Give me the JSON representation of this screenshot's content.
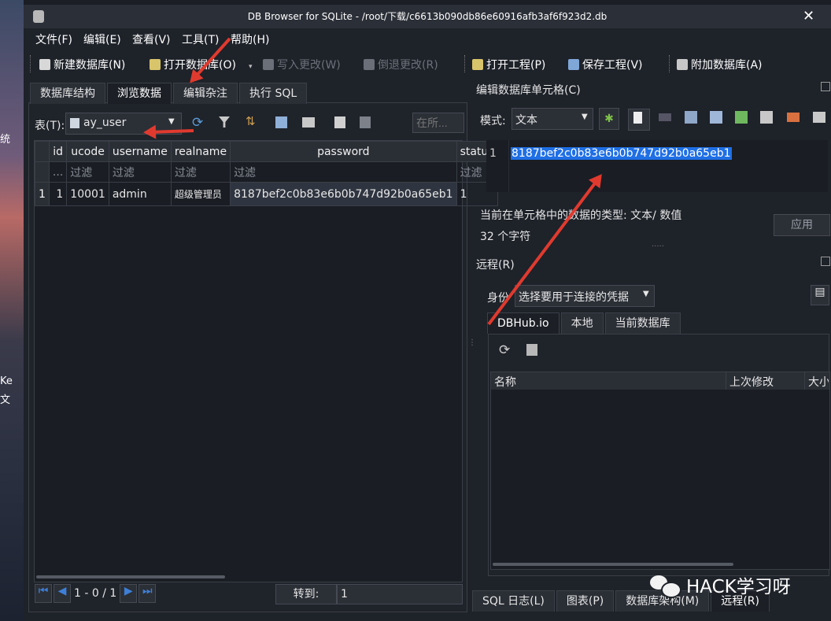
{
  "window": {
    "title": "DB Browser for SQLite - /root/下载/c6613b090db86e60916afb3af6f923d2.db"
  },
  "desktop": {
    "labels": [
      "统",
      "Ke",
      "文"
    ]
  },
  "menu": [
    "文件(F)",
    "编辑(E)",
    "查看(V)",
    "工具(T)",
    "帮助(H)"
  ],
  "toolbar": {
    "new_db": "新建数据库(N)",
    "open_db": "打开数据库(O)",
    "write": "写入更改(W)",
    "revert": "倒退更改(R)",
    "open_project": "打开工程(P)",
    "save_project": "保存工程(V)",
    "attach_db": "附加数据库(A)"
  },
  "left_tabs": [
    "数据库结构",
    "浏览数据",
    "编辑杂注",
    "执行 SQL"
  ],
  "browse": {
    "table_label": "表(T):",
    "table_value": "ay_user",
    "filter_all_placeholder": "在所...",
    "columns": [
      "id",
      "ucode",
      "username",
      "realname",
      "password",
      "status"
    ],
    "filter_row": [
      "...",
      "过滤",
      "过滤",
      "过滤",
      "过滤",
      "过滤"
    ],
    "rows": [
      {
        "rownum": "1",
        "cells": [
          "1",
          "10001",
          "admin",
          "超级管理员",
          "8187bef2c0b83e6b0b747d92b0a65eb1",
          "1"
        ]
      }
    ],
    "pager": {
      "range": "1 - 0 / 1",
      "goto_label": "转到:",
      "goto_value": "1"
    }
  },
  "edit_cell": {
    "title": "编辑数据库单元格(C)",
    "mode_label": "模式:",
    "mode_value": "文本",
    "line_number": "1",
    "value": "8187bef2c0b83e6b0b747d92b0a65eb1",
    "type_info": "当前在单元格中的数据的类型: 文本/ 数值",
    "char_count": "32 个字符",
    "apply": "应用"
  },
  "remote": {
    "title": "远程(R)",
    "identity_label": "身份",
    "identity_value": "选择要用于连接的凭据",
    "tabs": [
      "DBHub.io",
      "本地",
      "当前数据库"
    ],
    "columns": [
      "名称",
      "上次修改",
      "大小"
    ]
  },
  "bottom_tabs": [
    "SQL 日志(L)",
    "图表(P)",
    "数据库架构(M)",
    "远程(R)"
  ],
  "watermark": "HACK学习呀",
  "colors": {
    "selection": "#1f6fe5",
    "arrow": "#e03a2f",
    "background": "#1e2229"
  }
}
